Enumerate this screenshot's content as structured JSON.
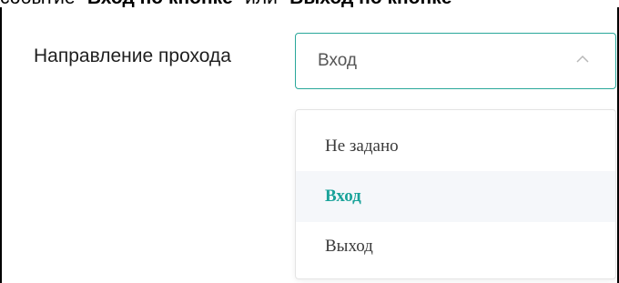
{
  "top_fragment": {
    "pre": "событие \"",
    "bold1": "Вход по кнопке",
    "mid": "\" или \"",
    "bold2": "Выход по кнопке"
  },
  "field": {
    "label": "Направление прохода",
    "selected_value": "Вход",
    "chevron_icon": "chevron-up-icon"
  },
  "dropdown": {
    "options": [
      {
        "label": "Не задано",
        "selected": false
      },
      {
        "label": "Вход",
        "selected": true
      },
      {
        "label": "Выход",
        "selected": false
      }
    ]
  },
  "colors": {
    "accent": "#2aa79a",
    "selected_text": "#1aa39a",
    "hover_bg": "#f5f7fa"
  }
}
